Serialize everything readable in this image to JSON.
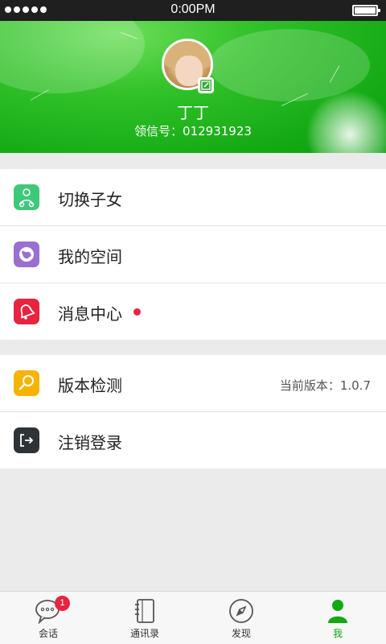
{
  "status_bar": {
    "time": "0:00PM"
  },
  "profile": {
    "name": "丁丁",
    "account": "领信号：012931923"
  },
  "menu_group_1": [
    {
      "label": "切换子女",
      "icon": "switch-child-icon",
      "color": "#3ec87a"
    },
    {
      "label": "我的空间",
      "icon": "globe-icon",
      "color": "#9b6fd0"
    },
    {
      "label": "消息中心",
      "icon": "bell-icon",
      "color": "#e8243f",
      "has_unread_dot": true
    }
  ],
  "menu_group_2": [
    {
      "label": "版本检测",
      "icon": "magnifier-icon",
      "color": "#f5b400",
      "value": "当前版本：1.0.7"
    },
    {
      "label": "注销登录",
      "icon": "logout-icon",
      "color": "#2f3338"
    }
  ],
  "tab_bar": [
    {
      "label": "会话",
      "icon": "chat-bubble-icon",
      "badge": "1",
      "active": false
    },
    {
      "label": "通讯录",
      "icon": "contacts-book-icon",
      "active": false
    },
    {
      "label": "发现",
      "icon": "compass-icon",
      "active": false
    },
    {
      "label": "我",
      "icon": "person-icon",
      "active": true
    }
  ],
  "colors": {
    "accent": "#12a813",
    "badge": "#e8243f",
    "background": "#ebebeb"
  }
}
